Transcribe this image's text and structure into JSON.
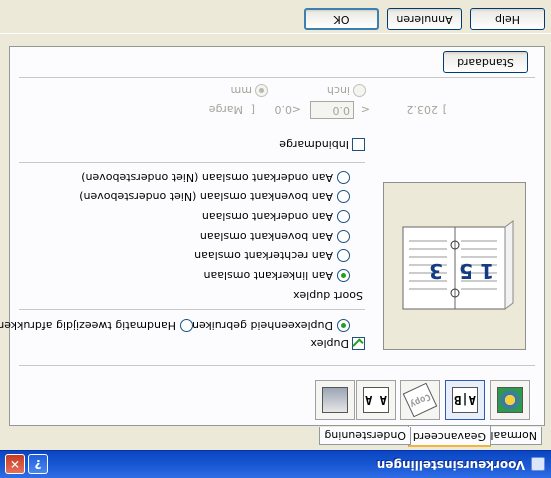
{
  "window": {
    "title": "Voorkeursinstellingen",
    "help_glyph": "?",
    "close_glyph": "✕"
  },
  "tabs": [
    {
      "label": "Normaal"
    },
    {
      "label": "Geavanceerd"
    },
    {
      "label": "Ondersteuning"
    }
  ],
  "icon_strip": [
    "color-quality-icon",
    "duplex-booklet-icon",
    "watermark-icon",
    "page-setting-icon",
    "device-options-icon"
  ],
  "duplex": {
    "checkbox_label": "Duplex",
    "checked": true,
    "mode_auto_label": "Duplexeenheid gebruiken",
    "mode_manual_label": "Handmatig tweezijdig afdrukken",
    "type_title": "Soort duplex",
    "options": [
      "Aan linkerkant omslaan",
      "Aan rechterkant omslaan",
      "Aan bovenkant omslaan",
      "Aan onderkant omslaan",
      "Aan bovenkant omslaan (Niet ondersteboven)",
      "Aan onderkant omslaan (Niet ondersteboven)"
    ],
    "selected_option": "Aan linkerkant omslaan"
  },
  "preview": {
    "left_page_digits": "1 5",
    "right_page_digit": "3"
  },
  "binding_offset": {
    "checkbox_label": "Inbindmarge",
    "margin_label": "Marge",
    "field_value": "0.0",
    "range_open": "[",
    "range_min": "0.0",
    "lt1": "<",
    "lt2": "<",
    "range_max": "203.2",
    "range_close": "]",
    "unit_mm": "mm",
    "unit_inch": "inch"
  },
  "buttons": {
    "default": "Standaard",
    "ok": "OK",
    "cancel": "Annuleren",
    "help": "Help"
  }
}
